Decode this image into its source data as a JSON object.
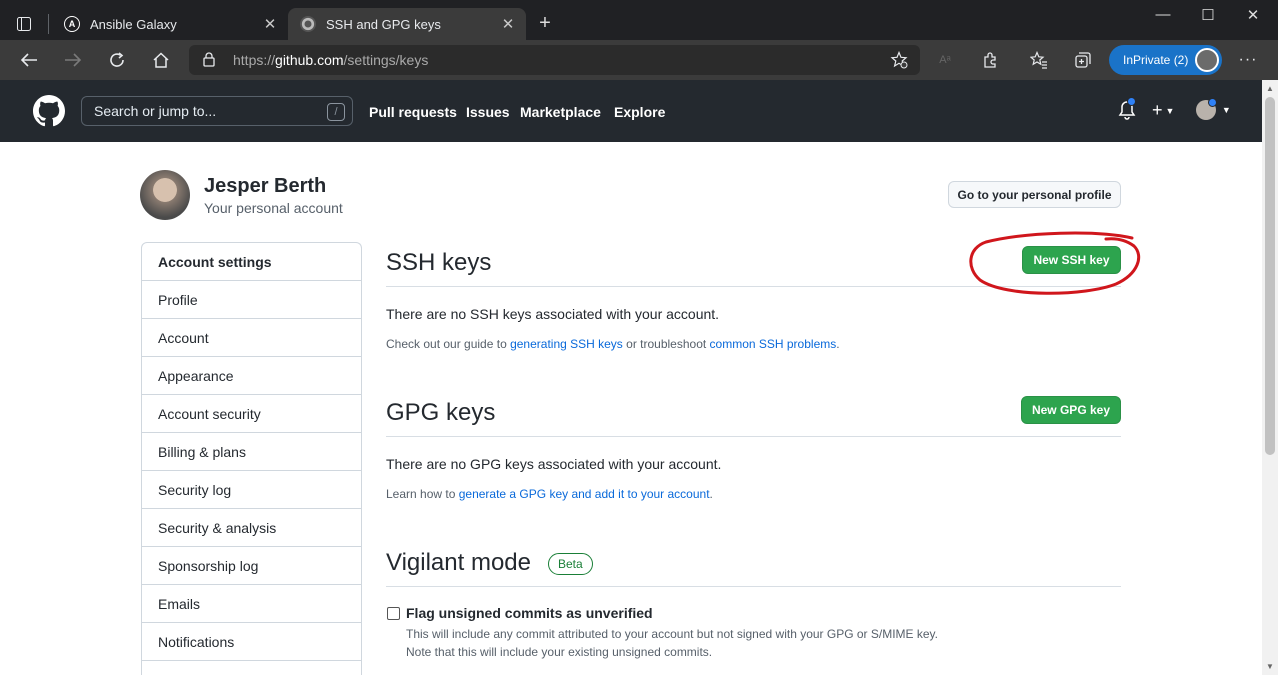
{
  "browser": {
    "tabs": [
      {
        "title": "Ansible Galaxy",
        "active": false
      },
      {
        "title": "SSH and GPG keys",
        "active": true
      }
    ],
    "url_prefix": "https://",
    "url_domain": "github.com",
    "url_path": "/settings/keys",
    "inprivate_label": "InPrivate (2)"
  },
  "github_header": {
    "search_placeholder": "Search or jump to...",
    "search_shortcut": "/",
    "nav": [
      "Pull requests",
      "Issues",
      "Marketplace",
      "Explore"
    ]
  },
  "profile": {
    "name": "Jesper Berth",
    "subtitle": "Your personal account",
    "profile_button": "Go to your personal profile"
  },
  "sidebar": {
    "items": [
      {
        "label": "Account settings"
      },
      {
        "label": "Profile"
      },
      {
        "label": "Account"
      },
      {
        "label": "Appearance"
      },
      {
        "label": "Account security"
      },
      {
        "label": "Billing & plans"
      },
      {
        "label": "Security log"
      },
      {
        "label": "Security & analysis"
      },
      {
        "label": "Sponsorship log"
      },
      {
        "label": "Emails"
      },
      {
        "label": "Notifications"
      }
    ]
  },
  "ssh": {
    "title": "SSH keys",
    "button": "New SSH key",
    "empty": "There are no SSH keys associated with your account.",
    "note_prefix": "Check out our guide to ",
    "note_link1": "generating SSH keys",
    "note_mid": " or troubleshoot ",
    "note_link2": "common SSH problems",
    "note_suffix": "."
  },
  "gpg": {
    "title": "GPG keys",
    "button": "New GPG key",
    "empty": "There are no GPG keys associated with your account.",
    "note_prefix": "Learn how to ",
    "note_link": "generate a GPG key and add it to your account",
    "note_suffix": "."
  },
  "vigilant": {
    "title": "Vigilant mode",
    "badge": "Beta",
    "checkbox_label": "Flag unsigned commits as unverified",
    "checked": false,
    "note1": "This will include any commit attributed to your account but not signed with your GPG or S/MIME key.",
    "note2": "Note that this will include your existing unsigned commits."
  },
  "colors": {
    "header_bg": "#24292f",
    "green_button": "#2da44e",
    "link": "#0969da",
    "annotation": "#d0161c"
  }
}
